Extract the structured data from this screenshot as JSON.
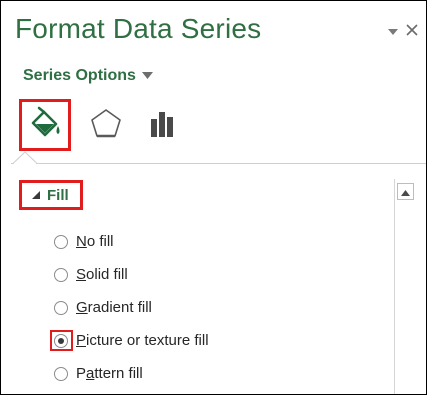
{
  "pane": {
    "title": "Format Data Series",
    "menu_icon": "chevron-down-icon",
    "close_icon": "close-icon",
    "series_dropdown": "Series Options"
  },
  "tabs": [
    {
      "icon": "paint-bucket-icon",
      "active": true
    },
    {
      "icon": "pentagon-icon",
      "active": false
    },
    {
      "icon": "bar-chart-icon",
      "active": false
    }
  ],
  "section": {
    "label": "Fill",
    "expanded": true
  },
  "fill_options": [
    {
      "label": "No fill",
      "accel": "N",
      "rest": "o fill",
      "selected": false
    },
    {
      "label": "Solid fill",
      "accel": "S",
      "rest": "olid fill",
      "selected": false
    },
    {
      "label": "Gradient fill",
      "accel": "G",
      "rest": "radient fill",
      "selected": false
    },
    {
      "label": "Picture or texture fill",
      "accel": "P",
      "rest": "icture or texture fill",
      "selected": true
    },
    {
      "label": "Pattern fill",
      "pre": "P",
      "accel": "a",
      "rest": "ttern fill",
      "selected": false
    }
  ],
  "colors": {
    "accent_green": "#2f6f43",
    "highlight_red": "#e11c1c"
  }
}
